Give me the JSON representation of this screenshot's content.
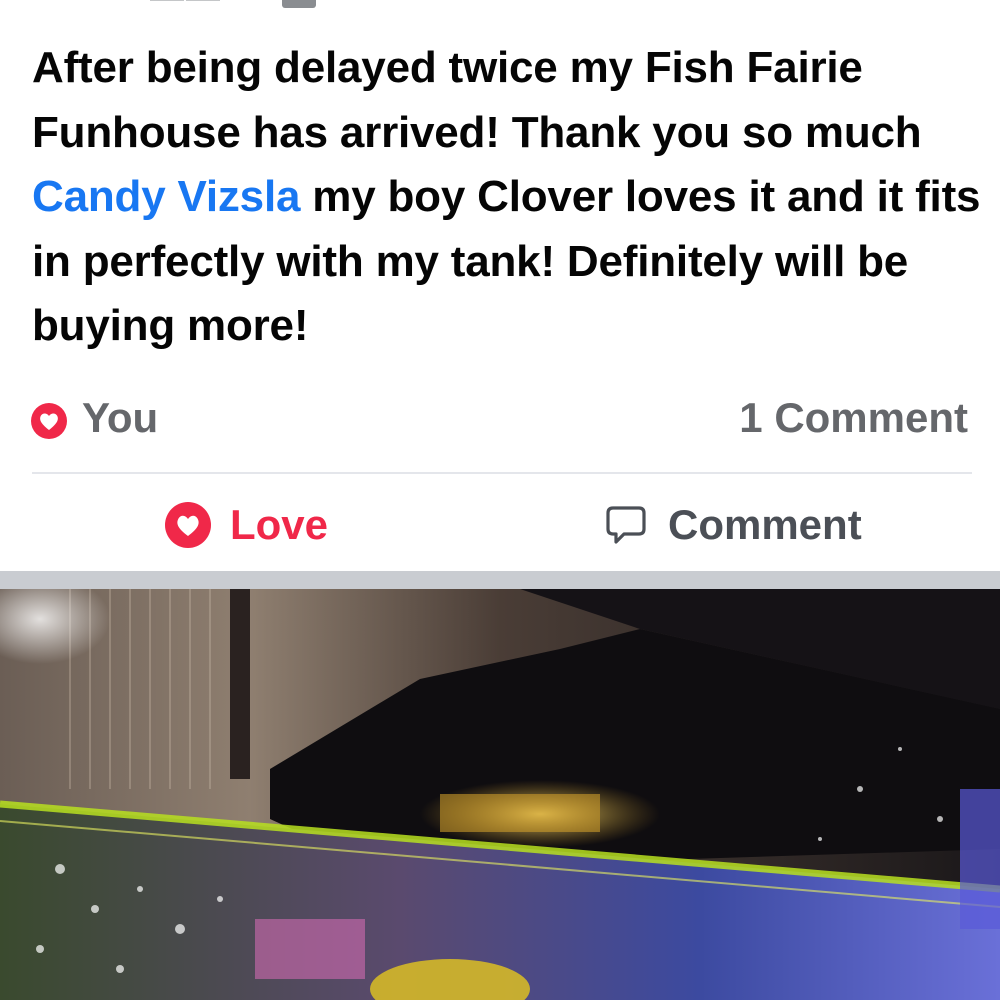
{
  "post": {
    "text_before_mention": "After being delayed twice my Fish Fairie Funhouse has arrived! Thank you so much ",
    "mention": "Candy Vizsla",
    "text_after_mention": " my boy Clover loves it and it fits in perfectly with my tank! Definitely will be buying more!"
  },
  "reactions": {
    "icon": "heart-reaction-icon",
    "label": "You",
    "comment_count": "1 Comment"
  },
  "actions": {
    "love_label": "Love",
    "comment_label": "Comment",
    "love_icon": "heart-icon",
    "comment_icon": "speech-bubble-icon"
  },
  "colors": {
    "text": "#050505",
    "mention": "#1877f2",
    "love": "#f02849",
    "muted": "#65676b",
    "separator": "#c9ccd1"
  }
}
